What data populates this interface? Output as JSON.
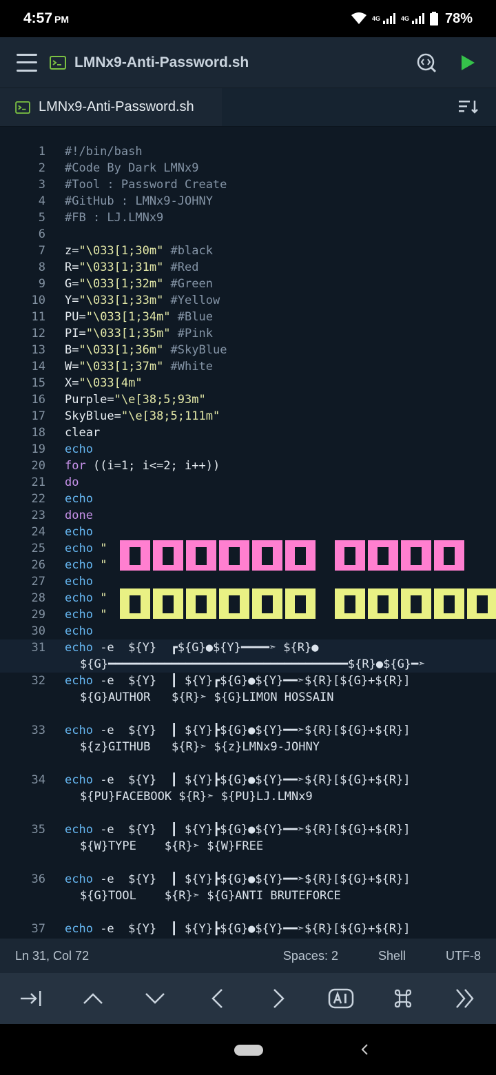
{
  "status_bar": {
    "time": "4:57",
    "ampm": "PM",
    "network_1": "4G",
    "network_2": "4G",
    "battery": "78%"
  },
  "app_bar": {
    "title": "LMNx9-Anti-Password.sh",
    "icons": [
      "menu-icon",
      "terminal-file-icon",
      "preview-icon",
      "run-icon"
    ]
  },
  "tab": {
    "label": "LMNx9-Anti-Password.sh"
  },
  "editor": {
    "lines": [
      {
        "n": "1",
        "segs": [
          {
            "t": "#!/bin/bash",
            "c": "c-com"
          }
        ]
      },
      {
        "n": "2",
        "segs": [
          {
            "t": "#Code By Dark LMNx9",
            "c": "c-com"
          }
        ]
      },
      {
        "n": "3",
        "segs": [
          {
            "t": "#Tool : Password Create",
            "c": "c-com"
          }
        ]
      },
      {
        "n": "4",
        "segs": [
          {
            "t": "#GitHub : LMNx9-JOHNY",
            "c": "c-com"
          }
        ]
      },
      {
        "n": "5",
        "segs": [
          {
            "t": "#FB : LJ.LMNx9",
            "c": "c-com"
          }
        ]
      },
      {
        "n": "6",
        "segs": []
      },
      {
        "n": "7",
        "segs": [
          {
            "t": "z=",
            "c": "c-plain"
          },
          {
            "t": "\"\\033[1;30m\"",
            "c": "c-str"
          },
          {
            "t": " #black",
            "c": "c-com"
          }
        ]
      },
      {
        "n": "8",
        "segs": [
          {
            "t": "R=",
            "c": "c-plain"
          },
          {
            "t": "\"\\033[1;31m\"",
            "c": "c-str"
          },
          {
            "t": " #Red",
            "c": "c-com"
          }
        ]
      },
      {
        "n": "9",
        "segs": [
          {
            "t": "G=",
            "c": "c-plain"
          },
          {
            "t": "\"\\033[1;32m\"",
            "c": "c-str"
          },
          {
            "t": " #Green",
            "c": "c-com"
          }
        ]
      },
      {
        "n": "10",
        "segs": [
          {
            "t": "Y=",
            "c": "c-plain"
          },
          {
            "t": "\"\\033[1;33m\"",
            "c": "c-str"
          },
          {
            "t": " #Yellow",
            "c": "c-com"
          }
        ]
      },
      {
        "n": "11",
        "segs": [
          {
            "t": "PU=",
            "c": "c-plain"
          },
          {
            "t": "\"\\033[1;34m\"",
            "c": "c-str"
          },
          {
            "t": " #Blue",
            "c": "c-com"
          }
        ]
      },
      {
        "n": "12",
        "segs": [
          {
            "t": "PI=",
            "c": "c-plain"
          },
          {
            "t": "\"\\033[1;35m\"",
            "c": "c-str"
          },
          {
            "t": " #Pink",
            "c": "c-com"
          }
        ]
      },
      {
        "n": "13",
        "segs": [
          {
            "t": "B=",
            "c": "c-plain"
          },
          {
            "t": "\"\\033[1;36m\"",
            "c": "c-str"
          },
          {
            "t": " #SkyBlue",
            "c": "c-com"
          }
        ]
      },
      {
        "n": "14",
        "segs": [
          {
            "t": "W=",
            "c": "c-plain"
          },
          {
            "t": "\"\\033[1;37m\"",
            "c": "c-str"
          },
          {
            "t": " #White",
            "c": "c-com"
          }
        ]
      },
      {
        "n": "15",
        "segs": [
          {
            "t": "X=",
            "c": "c-plain"
          },
          {
            "t": "\"\\033[4m\"",
            "c": "c-str"
          }
        ]
      },
      {
        "n": "16",
        "segs": [
          {
            "t": "Purple=",
            "c": "c-plain"
          },
          {
            "t": "\"\\e[38;5;93m\"",
            "c": "c-str"
          }
        ]
      },
      {
        "n": "17",
        "segs": [
          {
            "t": "SkyBlue=",
            "c": "c-plain"
          },
          {
            "t": "\"\\e[38;5;111m\"",
            "c": "c-str"
          }
        ]
      },
      {
        "n": "18",
        "segs": [
          {
            "t": "clear",
            "c": "c-plain"
          }
        ]
      },
      {
        "n": "19",
        "segs": [
          {
            "t": "echo",
            "c": "c-cmd"
          }
        ]
      },
      {
        "n": "20",
        "segs": [
          {
            "t": "for",
            "c": "c-kw"
          },
          {
            "t": " ((i=1; i<=2; i++))",
            "c": "c-plain"
          }
        ]
      },
      {
        "n": "21",
        "segs": [
          {
            "t": "do",
            "c": "c-kw"
          }
        ]
      },
      {
        "n": "22",
        "segs": [
          {
            "t": "echo",
            "c": "c-cmd"
          }
        ]
      },
      {
        "n": "23",
        "segs": [
          {
            "t": "done",
            "c": "c-kw"
          }
        ]
      },
      {
        "n": "24",
        "segs": [
          {
            "t": "echo",
            "c": "c-cmd"
          }
        ]
      },
      {
        "n": "25",
        "segs": [
          {
            "t": "echo",
            "c": "c-cmd"
          },
          {
            "t": " \"",
            "c": "c-str"
          }
        ]
      },
      {
        "n": "26",
        "segs": [
          {
            "t": "echo",
            "c": "c-cmd"
          },
          {
            "t": " \"",
            "c": "c-str"
          }
        ]
      },
      {
        "n": "27",
        "segs": [
          {
            "t": "echo",
            "c": "c-cmd"
          }
        ]
      },
      {
        "n": "28",
        "segs": [
          {
            "t": "echo",
            "c": "c-cmd"
          },
          {
            "t": " \"",
            "c": "c-str"
          }
        ]
      },
      {
        "n": "29",
        "segs": [
          {
            "t": "echo",
            "c": "c-cmd"
          },
          {
            "t": " \"",
            "c": "c-str"
          }
        ]
      },
      {
        "n": "30",
        "segs": [
          {
            "t": "echo",
            "c": "c-cmd"
          }
        ]
      },
      {
        "n": "31",
        "cur": true,
        "segs": [
          {
            "t": "echo",
            "c": "c-cmd"
          },
          {
            "t": " -e  ${Y}  ┏${G}●${Y}━━━━➣ ${R}●",
            "c": "c-op"
          }
        ]
      },
      {
        "n": "",
        "cont": true,
        "cur": true,
        "segs": [
          {
            "t": "${G}━━━━━━━━━━━━━━━━━━━━━━━━━━━━━━━━━━${R}●${G}━➣",
            "c": "c-op"
          }
        ]
      },
      {
        "n": "32",
        "segs": [
          {
            "t": "echo",
            "c": "c-cmd"
          },
          {
            "t": " -e  ${Y}  ┃ ${Y}┏${G}●${Y}━━➣${R}[${G}+${R}]",
            "c": "c-op"
          }
        ]
      },
      {
        "n": "",
        "cont": true,
        "segs": [
          {
            "t": "${G}AUTHOR   ${R}➣ ${G}LIMON HOSSAIN",
            "c": "c-op"
          }
        ]
      },
      {
        "n": "",
        "segs": []
      },
      {
        "n": "33",
        "segs": [
          {
            "t": "echo",
            "c": "c-cmd"
          },
          {
            "t": " -e  ${Y}  ┃ ${Y}┣${G}●${Y}━━➣${R}[${G}+${R}]",
            "c": "c-op"
          }
        ]
      },
      {
        "n": "",
        "cont": true,
        "segs": [
          {
            "t": "${z}GITHUB   ${R}➣ ${z}LMNx9-JOHNY",
            "c": "c-op"
          }
        ]
      },
      {
        "n": "",
        "segs": []
      },
      {
        "n": "34",
        "segs": [
          {
            "t": "echo",
            "c": "c-cmd"
          },
          {
            "t": " -e  ${Y}  ┃ ${Y}┣${G}●${Y}━━➣${R}[${G}+${R}]",
            "c": "c-op"
          }
        ]
      },
      {
        "n": "",
        "cont": true,
        "segs": [
          {
            "t": "${PU}FACEBOOK ${R}➣ ${PU}LJ.LMNx9",
            "c": "c-op"
          }
        ]
      },
      {
        "n": "",
        "segs": []
      },
      {
        "n": "35",
        "segs": [
          {
            "t": "echo",
            "c": "c-cmd"
          },
          {
            "t": " -e  ${Y}  ┃ ${Y}┣${G}●${Y}━━➣${R}[${G}+${R}]",
            "c": "c-op"
          }
        ]
      },
      {
        "n": "",
        "cont": true,
        "segs": [
          {
            "t": "${W}TYPE    ${R}➣ ${W}FREE",
            "c": "c-op"
          }
        ]
      },
      {
        "n": "",
        "segs": []
      },
      {
        "n": "36",
        "segs": [
          {
            "t": "echo",
            "c": "c-cmd"
          },
          {
            "t": " -e  ${Y}  ┃ ${Y}┣${G}●${Y}━━➣${R}[${G}+${R}]",
            "c": "c-op"
          }
        ]
      },
      {
        "n": "",
        "cont": true,
        "segs": [
          {
            "t": "${G}TOOL    ${R}➣ ${G}ANTI BRUTEFORCE",
            "c": "c-op"
          }
        ]
      },
      {
        "n": "",
        "segs": []
      },
      {
        "n": "37",
        "segs": [
          {
            "t": "echo",
            "c": "c-cmd"
          },
          {
            "t": " -e  ${Y}  ┃ ${Y}┣${G}●${Y}━━➣${R}[${G}+${R}]",
            "c": "c-op"
          }
        ]
      }
    ],
    "banner_colors": {
      "pink": "#ff7fd0",
      "yellow": "#e9f184"
    }
  },
  "status_line": {
    "position": "Ln 31, Col 72",
    "indent": "Spaces: 2",
    "language": "Shell",
    "encoding": "UTF-8"
  },
  "shortcut_bar": {
    "keys": [
      "tab-icon",
      "chevron-up-icon",
      "chevron-down-icon",
      "chevron-left-icon",
      "chevron-right-icon",
      "ai-icon",
      "command-icon",
      "double-chevron-right-icon"
    ]
  }
}
